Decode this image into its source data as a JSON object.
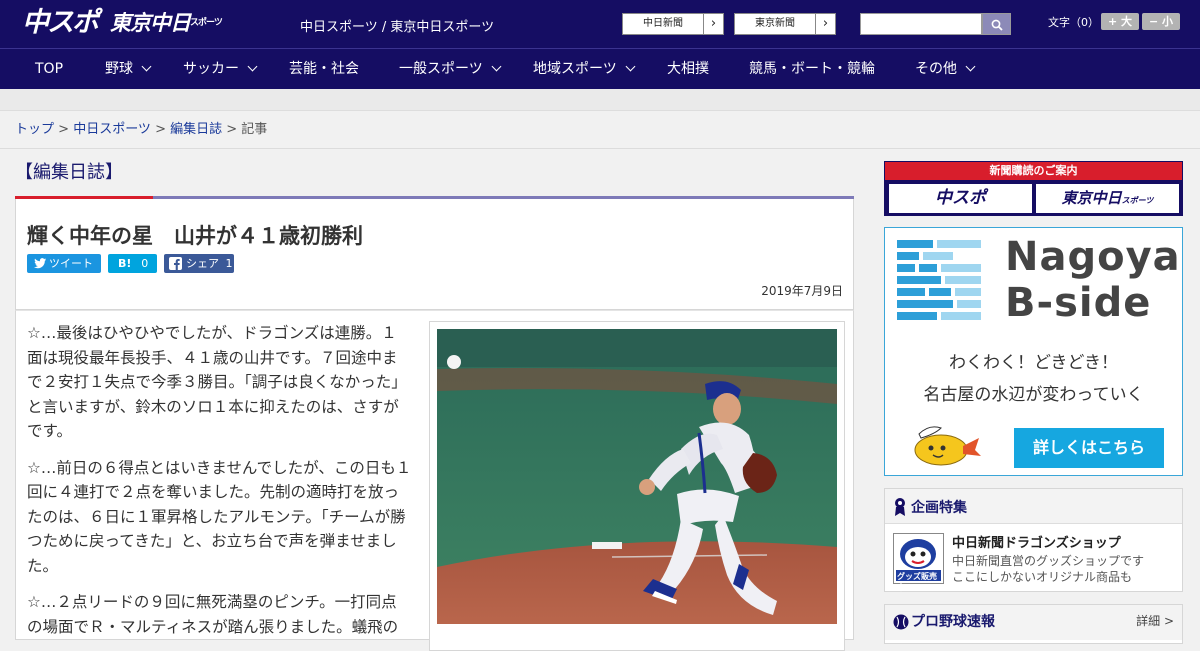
{
  "header": {
    "logo_chunichi": "中スポ",
    "logo_tokyo": "東京中日",
    "logo_tokyo_small": "スポーツ",
    "site_title": "中日スポーツ / 東京中日スポーツ",
    "ext_link_1": "中日新聞",
    "ext_link_2": "東京新聞",
    "ext_arrow": "›",
    "search_placeholder": "",
    "fontsize_label": "文字（0）",
    "fontsize_large": "+ 大",
    "fontsize_small": "− 小"
  },
  "nav": [
    {
      "label": "TOP",
      "dropdown": false
    },
    {
      "label": "野球",
      "dropdown": true
    },
    {
      "label": "サッカー",
      "dropdown": true
    },
    {
      "label": "芸能・社会",
      "dropdown": false
    },
    {
      "label": "一般スポーツ",
      "dropdown": true
    },
    {
      "label": "地域スポーツ",
      "dropdown": true
    },
    {
      "label": "大相撲",
      "dropdown": false
    },
    {
      "label": "競馬・ボート・競輪",
      "dropdown": false
    },
    {
      "label": "その他",
      "dropdown": true
    }
  ],
  "breadcrumb": {
    "home": "トップ",
    "sep": " > ",
    "section": "中日スポーツ",
    "category": "編集日誌",
    "current": "記事"
  },
  "article": {
    "section_heading": "【編集日誌】",
    "title": "輝く中年の星　山井が４１歳初勝利",
    "tweet_label": "ツイート",
    "hatena_label": "B!",
    "hatena_count": "0",
    "facebook_label": "シェア",
    "facebook_count": "1",
    "date": "2019年7月9日",
    "paragraphs": [
      "☆…最後はひやひやでしたが、ドラゴンズは連勝。１面は現役最年長投手、４１歳の山井です。７回途中まで２安打１失点で今季３勝目。「調子は良くなかった」と言いますが、鈴木のソロ１本に抑えたのは、さすがです。",
      "☆…前日の６得点とはいきませんでしたが、この日も１回に４連打で２点を奪いました。先制の適時打を放ったのは、６日に１軍昇格したアルモンテ。「チームが勝つために戻ってきた」と、お立ち台で声を弾ませました。",
      "☆…２点リードの９回に無死満塁のピンチ。一打同点の場面でＲ・マルティネスが踏ん張りました。蟻飛の"
    ],
    "photo_alt": "pitcher-photo"
  },
  "sidebar": {
    "subscribe_title": "新聞購読のご案内",
    "subscribe_btn_1": "中スポ",
    "subscribe_btn_2": "東京中日",
    "subscribe_btn_2_small": "スポーツ",
    "ad_title_1": "Nagoya",
    "ad_title_2": "B-side",
    "ad_sub_1": "わくわく！どきどき！",
    "ad_sub_2": "名古屋の水辺が変わっていく",
    "ad_button": "詳しくはこちら",
    "feature_heading": "企画特集",
    "feature_item_title": "中日新聞ドラゴンズショップ",
    "feature_item_desc_1": "中日新聞直営のグッズショップです",
    "feature_item_desc_2": "ここにしかないオリジナル商品も",
    "feature_thumb_label": "グッズ販売中",
    "baseball_heading": "プロ野球速報",
    "baseball_detail": "詳細 >"
  },
  "colors": {
    "header_bg": "#150d63",
    "accent_red": "#d81e2c",
    "link_blue": "#1a3a9a",
    "ad_blue": "#16a7e0"
  }
}
